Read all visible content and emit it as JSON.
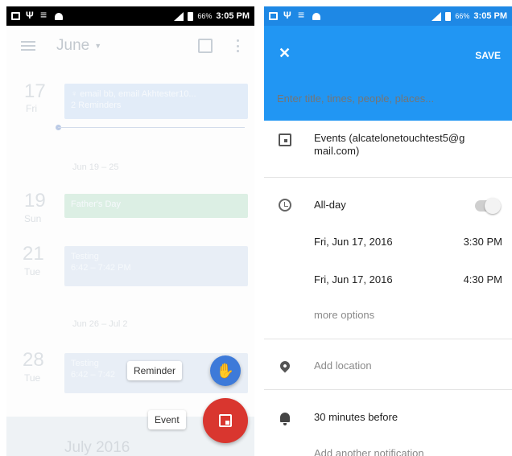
{
  "left": {
    "status": {
      "battery": "66%",
      "time": "3:05 PM"
    },
    "header": {
      "month": "June"
    },
    "days": [
      {
        "num": "17",
        "name": "Fri"
      },
      {
        "num": "19",
        "name": "Sun"
      },
      {
        "num": "21",
        "name": "Tue"
      },
      {
        "num": "28",
        "name": "Tue"
      }
    ],
    "events": [
      {
        "title": "♀ email bb, email Akhtester10...",
        "sub": "2 Reminders"
      },
      {
        "title": "Father's Day",
        "sub": ""
      },
      {
        "title": "Testing",
        "sub": "6:42 – 7:42 PM"
      },
      {
        "title": "Testing",
        "sub": "6:42 – 7:42"
      }
    ],
    "weeks": [
      "Jun 19 – 25",
      "Jun 26 – Jul 2"
    ],
    "next_month": "July 2016",
    "fab": {
      "reminder_label": "Reminder",
      "event_label": "Event"
    }
  },
  "right": {
    "status": {
      "battery": "66%",
      "time": "3:05 PM"
    },
    "appbar": {
      "close_icon": "✕",
      "save_label": "SAVE",
      "title_placeholder": "Enter title, times, people, places..."
    },
    "calendar": {
      "line1": "Events (alcatelonetouchtest5@g",
      "line2": "mail.com)"
    },
    "all_day_label": "All-day",
    "all_day_on": false,
    "start": {
      "date": "Fri, Jun 17, 2016",
      "time": "3:30 PM"
    },
    "end": {
      "date": "Fri, Jun 17, 2016",
      "time": "4:30 PM"
    },
    "more_options": "more options",
    "location_placeholder": "Add location",
    "notification": "30 minutes before",
    "add_notification": "Add another notification"
  },
  "colors": {
    "appbar": "#2196f3",
    "statusbar_right": "#1e88e5",
    "fab_reminder": "#3d7ad9",
    "fab_event": "#d9362f"
  },
  "icons": [
    "mail-icon",
    "usb-icon",
    "wifi-icon",
    "android-icon",
    "signal-icon",
    "battery-icon",
    "menu-icon",
    "calendar-icon",
    "more-vert-icon",
    "hand-icon",
    "event-icon",
    "close-icon",
    "clock-icon",
    "location-pin-icon",
    "bell-icon"
  ]
}
